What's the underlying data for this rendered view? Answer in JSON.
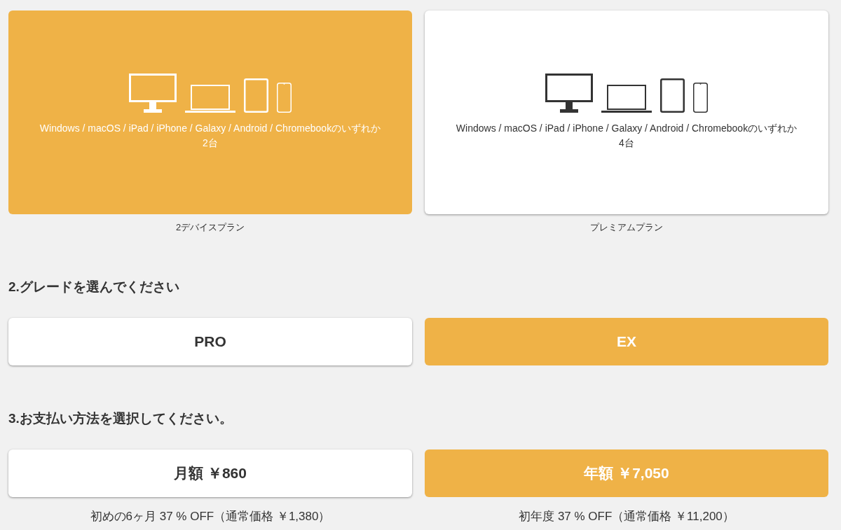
{
  "plans": [
    {
      "description": "Windows / macOS / iPad / iPhone / Galaxy / Android / Chromebookのいずれか",
      "count": "2台",
      "label": "2デバイスプラン",
      "selected": true
    },
    {
      "description": "Windows / macOS / iPad / iPhone / Galaxy / Android / Chromebookのいずれか",
      "count": "4台",
      "label": "プレミアムプラン",
      "selected": false
    }
  ],
  "grade": {
    "heading": "2.グレードを選んでください",
    "options": [
      {
        "label": "PRO",
        "selected": false
      },
      {
        "label": "EX",
        "selected": true
      }
    ]
  },
  "payment": {
    "heading": "3.お支払い方法を選択してください。",
    "options": [
      {
        "label": "月額 ￥860",
        "note": "初めの6ヶ月 37 % OFF（通常価格 ￥1,380）",
        "selected": false
      },
      {
        "label": "年額 ￥7,050",
        "note": "初年度 37 % OFF（通常価格 ￥11,200）",
        "selected": true
      }
    ]
  }
}
